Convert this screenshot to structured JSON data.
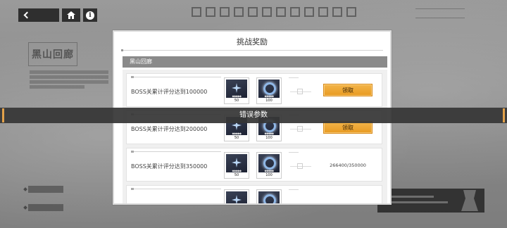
{
  "background": {
    "logo_text": "黑山回廊"
  },
  "nav": {
    "back_icon": "chevron-left-icon",
    "home_icon": "home-icon",
    "info_icon": "info-icon",
    "info_glyph": "i"
  },
  "modal": {
    "title": "挑战奖励",
    "section": "黑山回廊",
    "rows": [
      {
        "label": "BOSS关累计评分达到100000",
        "items": [
          {
            "icon": "crystal-shard-icon",
            "count": "50"
          },
          {
            "icon": "blue-ring-icon",
            "count": "100"
          }
        ],
        "action": "领取"
      },
      {
        "label": "BOSS关累计评分达到200000",
        "items": [
          {
            "icon": "crystal-shard-icon",
            "count": "50"
          },
          {
            "icon": "blue-ring-icon",
            "count": "100"
          }
        ],
        "action": "领取"
      },
      {
        "label": "BOSS关累计评分达到350000",
        "items": [
          {
            "icon": "crystal-shard-icon",
            "count": "50"
          },
          {
            "icon": "blue-ring-icon",
            "count": "100"
          }
        ],
        "progress": "266400/350000"
      },
      {
        "label": "",
        "items": [
          {
            "icon": "crystal-shard-icon",
            "count": ""
          },
          {
            "icon": "blue-ring-icon",
            "count": ""
          }
        ]
      }
    ]
  },
  "toast": {
    "message": "错误参数"
  },
  "colors": {
    "accent": "#eea531",
    "toast_bg": "#363636",
    "section_bg": "#8a8a8a"
  }
}
